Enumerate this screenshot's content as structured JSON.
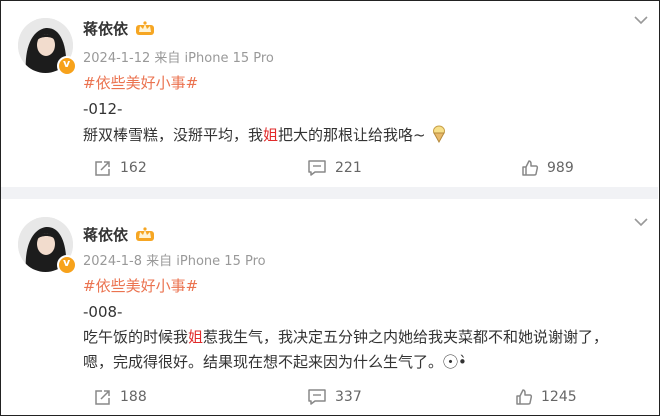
{
  "posts": [
    {
      "author": "蒋依依",
      "date": "2024-1-12",
      "source": "来自 iPhone 15 Pro",
      "topic": "#依些美好小事#",
      "number": "-012-",
      "line1_a": "掰双棒雪糕，没掰平均，我",
      "line1_hl": "姐",
      "line1_b": "把大的那根让给我咯~",
      "reposts": "162",
      "comments": "221",
      "likes": "989"
    },
    {
      "author": "蒋依依",
      "date": "2024-1-8",
      "source": "来自 iPhone 15 Pro",
      "topic": "#依些美好小事#",
      "number": "-008-",
      "line1_a": "吃午饭的时候我",
      "line1_hl": "姐",
      "line1_b": "惹我生气，我决定五分钟之内她给我夹菜都不和她说谢谢了，",
      "line2": "嗯，完成得很好。结果现在想不起来因为什么生气了。•⃝•̀",
      "reposts": "188",
      "comments": "337",
      "likes": "1245"
    }
  ],
  "colors": {
    "topic": "#eb7350",
    "highlight": "#e12b2b",
    "badge": "#f7a21b",
    "separator": "#f1f2f5"
  }
}
